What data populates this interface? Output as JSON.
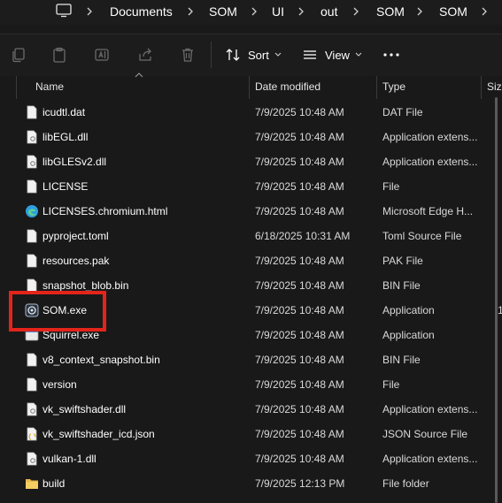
{
  "address_bar": {
    "crumbs": [
      "Documents",
      "SOM",
      "UI",
      "out",
      "SOM",
      "SOM"
    ]
  },
  "toolbar": {
    "sort_label": "Sort",
    "view_label": "View"
  },
  "columns": {
    "name": "Name",
    "date": "Date modified",
    "type": "Type",
    "size": "Siz"
  },
  "files": [
    {
      "name": "icudtl.dat",
      "date": "7/9/2025 10:48 AM",
      "type": "DAT File",
      "size": "",
      "icon": "file-icon"
    },
    {
      "name": "libEGL.dll",
      "date": "7/9/2025 10:48 AM",
      "type": "Application extens...",
      "size": "",
      "icon": "dll-icon"
    },
    {
      "name": "libGLESv2.dll",
      "date": "7/9/2025 10:48 AM",
      "type": "Application extens...",
      "size": "",
      "icon": "dll-icon"
    },
    {
      "name": "LICENSE",
      "date": "7/9/2025 10:48 AM",
      "type": "File",
      "size": "",
      "icon": "file-icon"
    },
    {
      "name": "LICENSES.chromium.html",
      "date": "7/9/2025 10:48 AM",
      "type": "Microsoft Edge H...",
      "size": "",
      "icon": "edge-icon"
    },
    {
      "name": "pyproject.toml",
      "date": "6/18/2025 10:31 AM",
      "type": "Toml Source File",
      "size": "",
      "icon": "file-icon"
    },
    {
      "name": "resources.pak",
      "date": "7/9/2025 10:48 AM",
      "type": "PAK File",
      "size": "",
      "icon": "file-icon"
    },
    {
      "name": "snapshot_blob.bin",
      "date": "7/9/2025 10:48 AM",
      "type": "BIN File",
      "size": "",
      "icon": "file-icon"
    },
    {
      "name": "SOM.exe",
      "date": "7/9/2025 10:48 AM",
      "type": "Application",
      "size": "1",
      "icon": "app-exe-icon"
    },
    {
      "name": "Squirrel.exe",
      "date": "7/9/2025 10:48 AM",
      "type": "Application",
      "size": "",
      "icon": "exe-icon"
    },
    {
      "name": "v8_context_snapshot.bin",
      "date": "7/9/2025 10:48 AM",
      "type": "BIN File",
      "size": "",
      "icon": "file-icon"
    },
    {
      "name": "version",
      "date": "7/9/2025 10:48 AM",
      "type": "File",
      "size": "",
      "icon": "file-icon"
    },
    {
      "name": "vk_swiftshader.dll",
      "date": "7/9/2025 10:48 AM",
      "type": "Application extens...",
      "size": "",
      "icon": "dll-icon"
    },
    {
      "name": "vk_swiftshader_icd.json",
      "date": "7/9/2025 10:48 AM",
      "type": "JSON Source File",
      "size": "",
      "icon": "json-icon"
    },
    {
      "name": "vulkan-1.dll",
      "date": "7/9/2025 10:48 AM",
      "type": "Application extens...",
      "size": "",
      "icon": "dll-icon"
    },
    {
      "name": "build",
      "date": "7/9/2025 12:13 PM",
      "type": "File folder",
      "size": "",
      "icon": "folder-icon"
    }
  ],
  "colors": {
    "background": "#191919",
    "highlight": "#e3241b",
    "folder": "#e8b84a",
    "edge": "#2f9fe0"
  }
}
